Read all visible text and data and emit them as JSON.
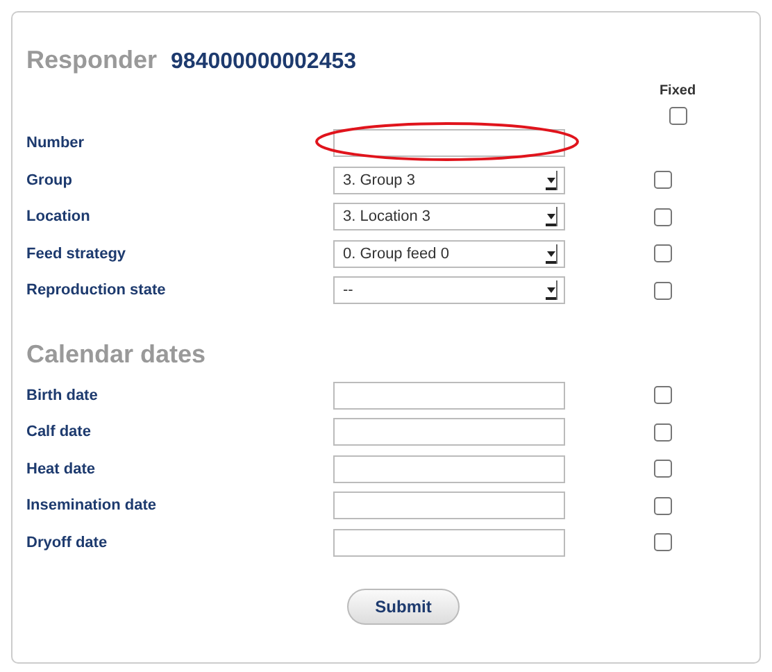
{
  "header": {
    "title": "Responder",
    "responder_id": "984000000002453",
    "fixed_label": "Fixed",
    "fixed_all": false
  },
  "rows": [
    {
      "label": "Number",
      "kind": "text",
      "value": "",
      "highlighted": true
    },
    {
      "label": "Group",
      "kind": "select",
      "value": "3. Group 3",
      "fixed": false
    },
    {
      "label": "Location",
      "kind": "select",
      "value": "3. Location 3",
      "fixed": false
    },
    {
      "label": "Feed strategy",
      "kind": "select",
      "value": "0. Group feed 0",
      "fixed": false
    },
    {
      "label": "Reproduction state",
      "kind": "select",
      "value": "--",
      "fixed": false
    }
  ],
  "calendar": {
    "title": "Calendar dates",
    "rows": [
      {
        "label": "Birth date",
        "kind": "text",
        "value": "",
        "fixed": false
      },
      {
        "label": "Calf date",
        "kind": "text",
        "value": "",
        "fixed": false
      },
      {
        "label": "Heat date",
        "kind": "text",
        "value": "",
        "fixed": false
      },
      {
        "label": "Insemination date",
        "kind": "text",
        "value": "",
        "fixed": false
      },
      {
        "label": "Dryoff date",
        "kind": "text",
        "value": "",
        "fixed": false
      }
    ]
  },
  "submit": "Submit"
}
